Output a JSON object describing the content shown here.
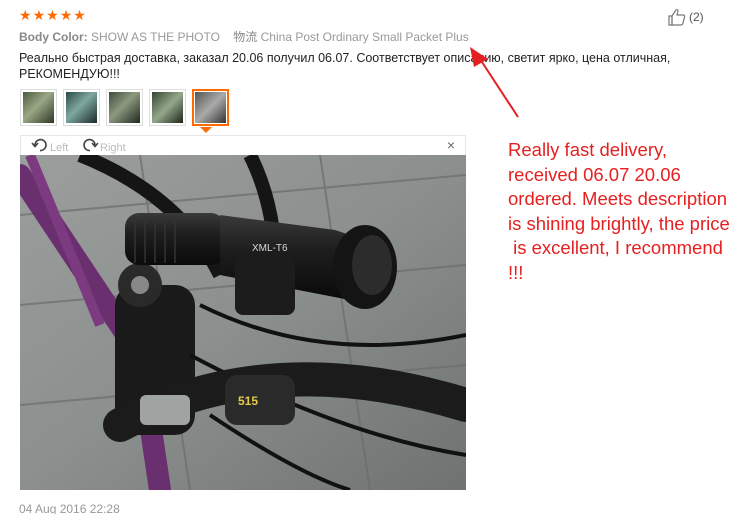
{
  "review": {
    "rating_stars": [
      "★",
      "★",
      "★",
      "★",
      "★"
    ],
    "body_color_label": "Body Color:",
    "body_color_value": "SHOW AS THE PHOTO",
    "shipping_label": "物流",
    "shipping_value": "China Post Ordinary Small Packet Plus",
    "text": "Реально быстрая доставка, заказал 20.06 получил 06.07. Соответствует описанию, светит ярко, цена отличная, РЕКОМЕНДУЮ!!!",
    "helpful_count": "(2)",
    "date": "04 Aug 2016 22:28"
  },
  "viewer": {
    "rotate_left_label": "Left",
    "rotate_right_label": "Right",
    "close_label": "×",
    "photo_text": "XML-T6",
    "photo_badge": "515"
  },
  "annotation": {
    "color": "#e52020",
    "text": "Really fast delivery,\nreceived 06.07 20.06\nordered. Meets description\nis shining brightly, the price\n is excellent, I recommend\n!!!"
  },
  "icons": {
    "helpful": "thumbs-up-icon",
    "rotate_left": "rotate-left-icon",
    "rotate_right": "rotate-right-icon",
    "close": "close-icon"
  },
  "colors": {
    "accent": "#ff6a00",
    "annotation": "#e52020"
  }
}
